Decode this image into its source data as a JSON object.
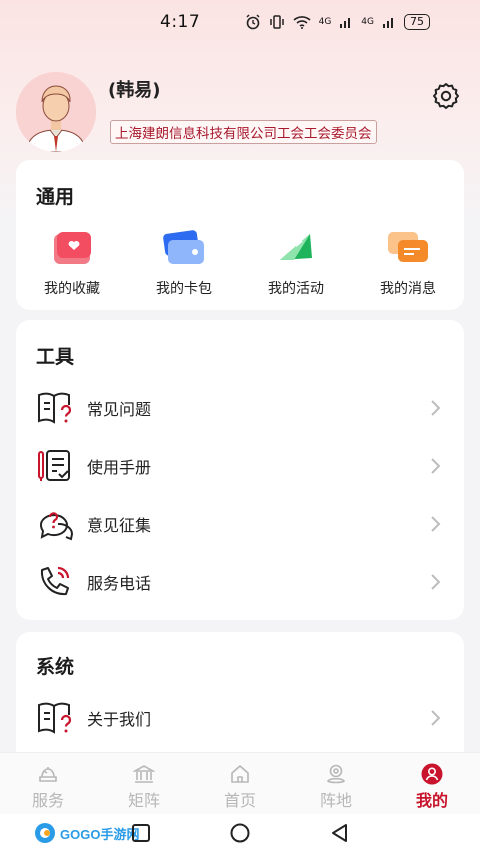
{
  "status_bar": {
    "time": "4:17",
    "network_1": "4G",
    "network_2": "4G",
    "battery": "75"
  },
  "profile": {
    "name": "(韩易)",
    "organization": "上海建朗信息科技有限公司工会工会委员会"
  },
  "general": {
    "title": "通用",
    "items": [
      {
        "label": "我的收藏",
        "icon": "favorites-icon"
      },
      {
        "label": "我的卡包",
        "icon": "card-wallet-icon"
      },
      {
        "label": "我的活动",
        "icon": "activity-flag-icon"
      },
      {
        "label": "我的消息",
        "icon": "message-icon"
      }
    ]
  },
  "tools": {
    "title": "工具",
    "items": [
      {
        "label": "常见问题",
        "icon": "faq-book-icon"
      },
      {
        "label": "使用手册",
        "icon": "manual-icon"
      },
      {
        "label": "意见征集",
        "icon": "feedback-icon"
      },
      {
        "label": "服务电话",
        "icon": "phone-icon"
      }
    ]
  },
  "system": {
    "title": "系统",
    "items": [
      {
        "label": "关于我们",
        "icon": "about-book-icon"
      }
    ]
  },
  "tab_bar": {
    "tabs": [
      {
        "label": "服务",
        "active": false
      },
      {
        "label": "矩阵",
        "active": false
      },
      {
        "label": "首页",
        "active": false
      },
      {
        "label": "阵地",
        "active": false
      },
      {
        "label": "我的",
        "active": true
      }
    ]
  },
  "watermark": {
    "text": "GOGO手游网"
  },
  "colors": {
    "accent": "#c8142c",
    "inactive": "#b7b7b7",
    "background": "#f4f4f6"
  }
}
